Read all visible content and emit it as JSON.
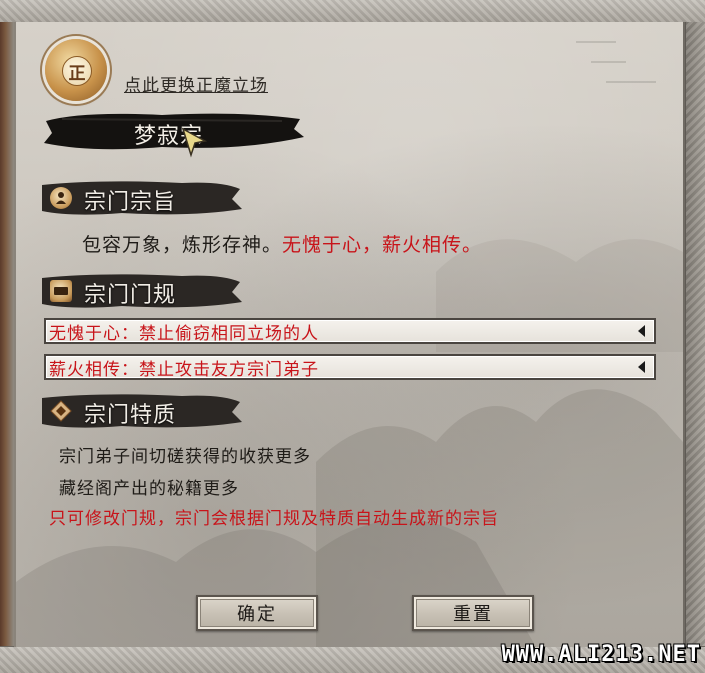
{
  "alignment": {
    "emblem_char": "正",
    "switch_label": "点此更换正魔立场"
  },
  "sect": {
    "name": "梦寂宗"
  },
  "tenet": {
    "header": "宗门宗旨",
    "text_normal": "包容万象，炼形存神。",
    "text_red": "无愧于心，薪火相传。"
  },
  "rules": {
    "header": "宗门门规",
    "items": [
      {
        "text": "无愧于心：禁止偷窃相同立场的人"
      },
      {
        "text": "薪火相传：禁止攻击友方宗门弟子"
      }
    ]
  },
  "traits": {
    "header": "宗门特质",
    "items": [
      "宗门弟子间切磋获得的收获更多",
      "藏经阁产出的秘籍更多"
    ],
    "hint": "只可修改门规，宗门会根据门规及特质自动生成新的宗旨"
  },
  "buttons": {
    "confirm": "确定",
    "reset": "重置"
  },
  "watermark": "WWW.ALI213.NET",
  "colors": {
    "highlight_red": "#c8141a",
    "ink_dark": "#1f1c18",
    "parchment": "#d6d1c9"
  }
}
